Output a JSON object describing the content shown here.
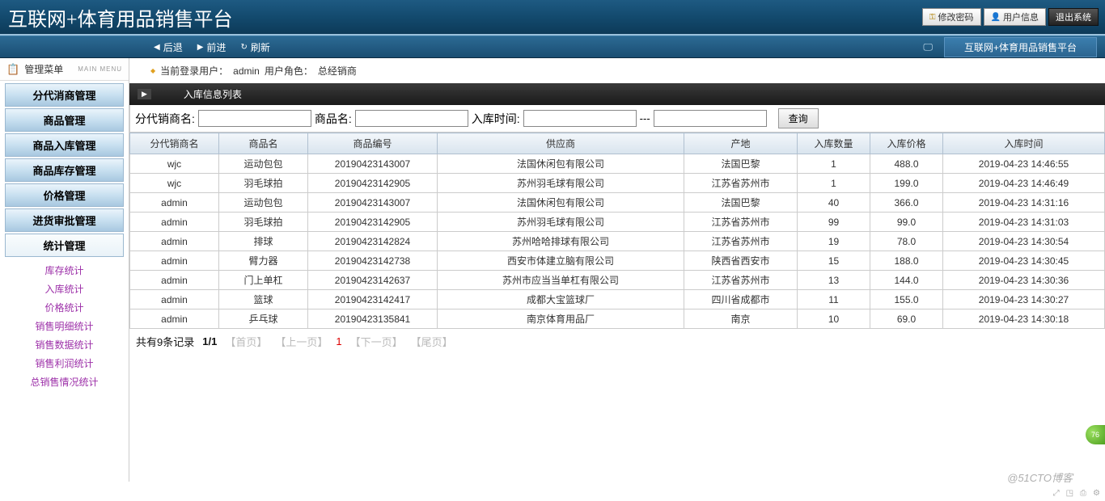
{
  "header": {
    "title": "互联网+体育用品销售平台",
    "change_pw": "修改密码",
    "user_info": "用户信息",
    "logout": "退出系统"
  },
  "toolbar": {
    "back": "后退",
    "forward": "前进",
    "refresh": "刷新",
    "context_title": "互联网+体育用品销售平台"
  },
  "sidebar": {
    "menu_title": "管理菜单",
    "main_menu_label": "MAIN MENU",
    "items": [
      {
        "label": "分代消商管理"
      },
      {
        "label": "商品管理"
      },
      {
        "label": "商品入库管理"
      },
      {
        "label": "商品库存管理"
      },
      {
        "label": "价格管理"
      },
      {
        "label": "进货审批管理"
      },
      {
        "label": "统计管理"
      }
    ],
    "subitems": [
      {
        "label": "库存统计"
      },
      {
        "label": "入库统计"
      },
      {
        "label": "价格统计"
      },
      {
        "label": "销售明细统计"
      },
      {
        "label": "销售数据统计"
      },
      {
        "label": "销售利润统计"
      },
      {
        "label": "总销售情况统计"
      }
    ]
  },
  "userbar": {
    "prefix": "当前登录用户：",
    "user": "admin",
    "role_prefix": "用户角色：",
    "role": "总经销商"
  },
  "content_title": "入库信息列表",
  "search": {
    "distributor_label": "分代销商名:",
    "product_label": "商品名:",
    "intime_label": "入库时间:",
    "separator": "---",
    "btn": "查询"
  },
  "table": {
    "cols": [
      "分代销商名",
      "商品名",
      "商品编号",
      "供应商",
      "产地",
      "入库数量",
      "入库价格",
      "入库时间"
    ],
    "rows": [
      [
        "wjc",
        "运动包包",
        "20190423143007",
        "法国休闲包有限公司",
        "法国巴黎",
        "1",
        "488.0",
        "2019-04-23 14:46:55"
      ],
      [
        "wjc",
        "羽毛球拍",
        "20190423142905",
        "苏州羽毛球有限公司",
        "江苏省苏州市",
        "1",
        "199.0",
        "2019-04-23 14:46:49"
      ],
      [
        "admin",
        "运动包包",
        "20190423143007",
        "法国休闲包有限公司",
        "法国巴黎",
        "40",
        "366.0",
        "2019-04-23 14:31:16"
      ],
      [
        "admin",
        "羽毛球拍",
        "20190423142905",
        "苏州羽毛球有限公司",
        "江苏省苏州市",
        "99",
        "99.0",
        "2019-04-23 14:31:03"
      ],
      [
        "admin",
        "排球",
        "20190423142824",
        "苏州哈哈排球有限公司",
        "江苏省苏州市",
        "19",
        "78.0",
        "2019-04-23 14:30:54"
      ],
      [
        "admin",
        "臂力器",
        "20190423142738",
        "西安市体建立脑有限公司",
        "陕西省西安市",
        "15",
        "188.0",
        "2019-04-23 14:30:45"
      ],
      [
        "admin",
        "门上单杠",
        "20190423142637",
        "苏州市应当当单杠有限公司",
        "江苏省苏州市",
        "13",
        "144.0",
        "2019-04-23 14:30:36"
      ],
      [
        "admin",
        "篮球",
        "20190423142417",
        "成都大宝篮球厂",
        "四川省成都市",
        "11",
        "155.0",
        "2019-04-23 14:30:27"
      ],
      [
        "admin",
        "乒乓球",
        "20190423135841",
        "南京体育用品厂",
        "南京",
        "10",
        "69.0",
        "2019-04-23 14:30:18"
      ]
    ]
  },
  "pager": {
    "total_text": "共有9条记录",
    "page_pos": "1/1",
    "first": "【首页】",
    "prev": "【上一页】",
    "cur": "1",
    "next": "【下一页】",
    "last": "【尾页】"
  },
  "watermark": "@51CTO博客",
  "badge": "76"
}
